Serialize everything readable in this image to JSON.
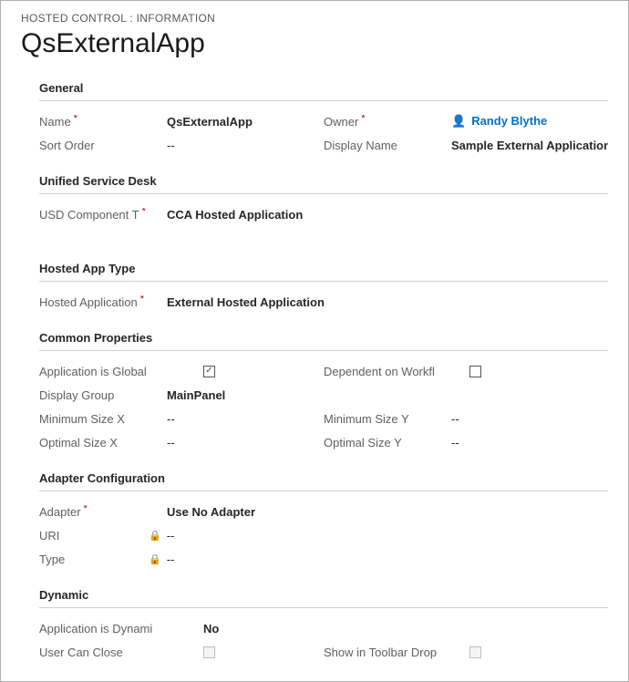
{
  "breadcrumb": "HOSTED CONTROL : INFORMATION",
  "page_title": "QsExternalApp",
  "sections": {
    "general": {
      "header": "General",
      "name_label": "Name",
      "name_value": "QsExternalApp",
      "owner_label": "Owner",
      "owner_value": "Randy Blythe",
      "sort_order_label": "Sort Order",
      "sort_order_value": "--",
      "display_name_label": "Display Name",
      "display_name_value": "Sample External Application"
    },
    "usd": {
      "header": "Unified Service Desk",
      "component_type_label": "USD Component T",
      "component_type_value": "CCA Hosted Application"
    },
    "hosted_app_type": {
      "header": "Hosted App Type",
      "hosted_app_label": "Hosted Application",
      "hosted_app_value": "External Hosted Application"
    },
    "common": {
      "header": "Common Properties",
      "app_global_label": "Application is Global",
      "dep_workflow_label": "Dependent on Workfl",
      "display_group_label": "Display Group",
      "display_group_value": "MainPanel",
      "min_x_label": "Minimum Size X",
      "min_x_value": "--",
      "min_y_label": "Minimum Size Y",
      "min_y_value": "--",
      "opt_x_label": "Optimal Size X",
      "opt_x_value": "--",
      "opt_y_label": "Optimal Size Y",
      "opt_y_value": "--"
    },
    "adapter": {
      "header": "Adapter Configuration",
      "adapter_label": "Adapter",
      "adapter_value": "Use No Adapter",
      "uri_label": "URI",
      "uri_value": "--",
      "type_label": "Type",
      "type_value": "--"
    },
    "dynamic": {
      "header": "Dynamic",
      "app_dynamic_label": "Application is Dynami",
      "app_dynamic_value": "No",
      "user_close_label": "User Can Close",
      "show_toolbar_label": "Show in Toolbar Drop"
    }
  },
  "checkmark": "✓"
}
